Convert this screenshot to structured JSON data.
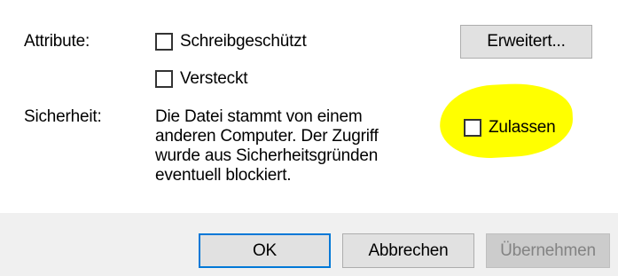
{
  "attributes": {
    "label": "Attribute:",
    "readonly": {
      "label": "Schreibgeschützt",
      "checked": false
    },
    "hidden": {
      "label": "Versteckt",
      "checked": false
    },
    "advanced_button": "Erweitert..."
  },
  "security": {
    "label": "Sicherheit:",
    "lines": [
      "Die Datei stammt von einem",
      "anderen Computer. Der Zugriff",
      "wurde aus Sicherheitsgründen",
      "eventuell blockiert."
    ],
    "allow": {
      "label": "Zulassen",
      "checked": false
    },
    "highlight_color": "#ffff00"
  },
  "buttons": {
    "ok": "OK",
    "cancel": "Abbrechen",
    "apply": "Übernehmen"
  },
  "colors": {
    "default_button_border": "#0078d7",
    "footer_background": "#f0f0f0"
  }
}
